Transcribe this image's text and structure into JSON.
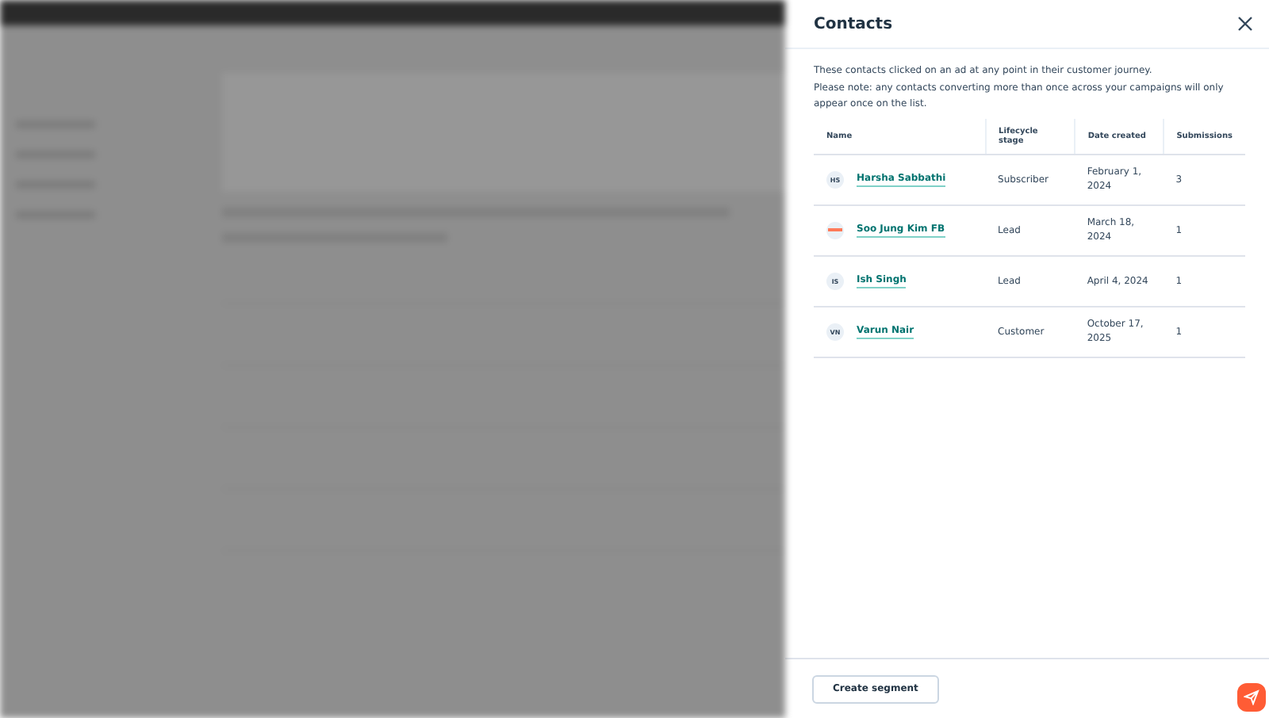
{
  "panel": {
    "title": "Contacts",
    "description": [
      "These contacts clicked on an ad at any point in their customer journey.",
      "Please note: any contacts converting more than once across your campaigns will only appear once on the list."
    ],
    "table": {
      "columns": [
        "Name",
        "Lifecycle stage",
        "Date created",
        "Submissions"
      ],
      "rows": [
        {
          "avatar": {
            "kind": "initials",
            "text": "HS"
          },
          "name": "Harsha Sabbathi",
          "stage": "Subscriber",
          "date": "February 1, 2024",
          "submissions": "3"
        },
        {
          "avatar": {
            "kind": "logo"
          },
          "name": "Soo Jung Kim FB",
          "stage": "Lead",
          "date": "March 18, 2024",
          "submissions": "1"
        },
        {
          "avatar": {
            "kind": "initials",
            "text": "IS"
          },
          "name": "Ish Singh",
          "stage": "Lead",
          "date": "April 4, 2024",
          "submissions": "1"
        },
        {
          "avatar": {
            "kind": "initials",
            "text": "VN"
          },
          "name": "Varun Nair",
          "stage": "Customer",
          "date": "October 17, 2025",
          "submissions": "1"
        }
      ]
    },
    "footer_button": "Create segment"
  }
}
